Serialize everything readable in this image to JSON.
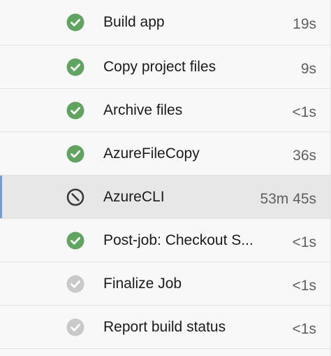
{
  "steps": [
    {
      "name": "Build app",
      "duration": "19s",
      "status": "succeeded",
      "icon": "check-circle-icon"
    },
    {
      "name": "Copy project files",
      "duration": "9s",
      "status": "succeeded",
      "icon": "check-circle-icon"
    },
    {
      "name": "Archive files",
      "duration": "<1s",
      "status": "succeeded",
      "icon": "check-circle-icon"
    },
    {
      "name": "AzureFileCopy",
      "duration": "36s",
      "status": "succeeded",
      "icon": "check-circle-icon"
    },
    {
      "name": "AzureCLI",
      "duration": "53m 45s",
      "status": "canceled",
      "icon": "canceled-icon",
      "selected": true
    },
    {
      "name": "Post-job: Checkout S...",
      "duration": "<1s",
      "status": "succeeded",
      "icon": "check-circle-icon"
    },
    {
      "name": "Finalize Job",
      "duration": "<1s",
      "status": "skipped",
      "icon": "check-circle-gray-icon"
    },
    {
      "name": "Report build status",
      "duration": "<1s",
      "status": "skipped",
      "icon": "check-circle-gray-icon"
    }
  ],
  "colors": {
    "success": "#5fa55f",
    "skipped": "#c9c9c9",
    "canceled": "#3a3a3a",
    "selected_accent": "#6e9fd8"
  }
}
